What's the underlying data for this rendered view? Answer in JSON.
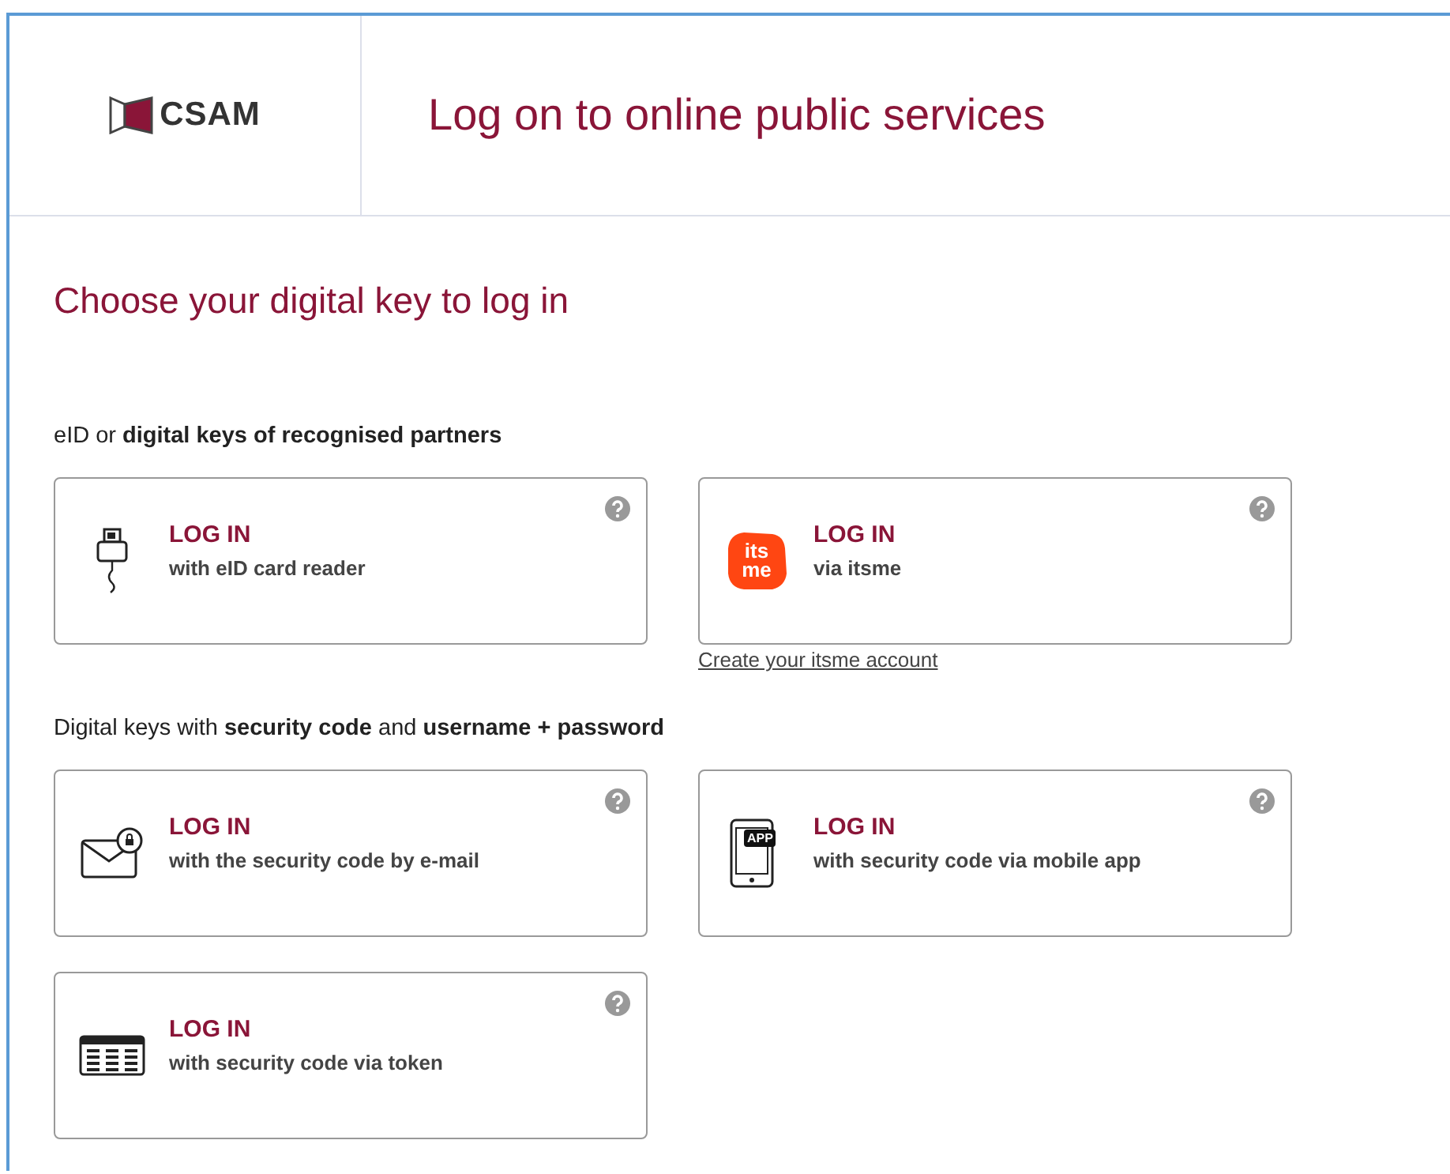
{
  "header": {
    "logo_text": "CSAM",
    "title": "Log on to online public services"
  },
  "heading": "Choose your digital key to log in",
  "sections": [
    {
      "title": "eID or **digital keys of recognised partners**",
      "cards": [
        {
          "kind": "card-reader",
          "action": "LOG IN",
          "subtitle": "with eID card reader"
        },
        {
          "kind": "itsme",
          "action": "LOG IN",
          "subtitle": "via itsme",
          "icon_text": [
            "its",
            "me"
          ],
          "link": "Create your itsme account"
        }
      ]
    },
    {
      "title": "Digital keys with **security code** and **username + password**",
      "cards": [
        {
          "kind": "email",
          "action": "LOG IN",
          "subtitle": "with the security code by e-mail"
        },
        {
          "kind": "mobile",
          "action": "LOG IN",
          "subtitle": "with security code via mobile app",
          "icon_text": [
            "APP"
          ]
        },
        {
          "kind": "token",
          "action": "LOG IN",
          "subtitle": "with security code via token"
        }
      ]
    }
  ]
}
